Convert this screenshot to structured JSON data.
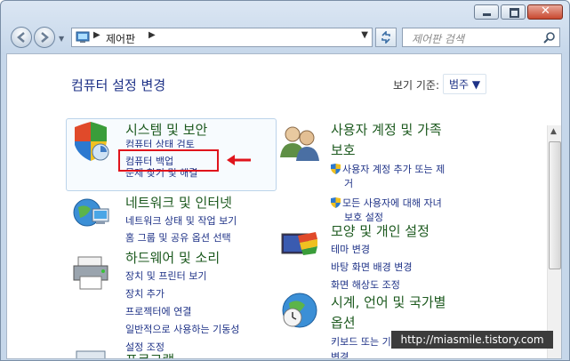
{
  "address": {
    "crumb": "제어판"
  },
  "search": {
    "placeholder": "제어판 검색"
  },
  "header": {
    "title": "컴퓨터 설정 변경",
    "view_by_label": "보기 기준:",
    "view_by_value": "범주 ▼"
  },
  "categories": [
    {
      "title": "시스템 및 보안",
      "links": [
        "컴퓨터 상태 검토",
        "컴퓨터 백업",
        "문제 찾기 및 해결"
      ]
    },
    {
      "title": "네트워크 및 인터넷",
      "links": [
        "네트워크 상태 및 작업 보기",
        "홈 그룹 및 공유 옵션 선택"
      ]
    },
    {
      "title": "하드웨어 및 소리",
      "links": [
        "장치 및 프린터 보기",
        "장치 추가",
        "프로젝터에 연결",
        "일반적으로 사용하는 기동성",
        "설정 조정"
      ]
    },
    {
      "title": "프로그램",
      "links": []
    },
    {
      "title_line1": "사용자 계정 및 가족",
      "title_line2": "보호",
      "links": [
        "사용자 계정 추가 또는 제",
        "거",
        "모든 사용자에 대해 자녀",
        "보호 설정"
      ]
    },
    {
      "title": "모양 및 개인 설정",
      "links": [
        "테마 변경",
        "바탕 화면 배경 변경",
        "화면 해상도 조정"
      ]
    },
    {
      "title_line1": "시계, 언어 및 국가별",
      "title_line2": "옵션",
      "links": [
        "키보드 또는 기타 입력 방법",
        "변경"
      ]
    }
  ],
  "watermark": "http://miasmile.tistory.com",
  "colors": {
    "highlight_border": "#e0141c",
    "link": "#1e3287",
    "title": "#1d5a1f"
  }
}
